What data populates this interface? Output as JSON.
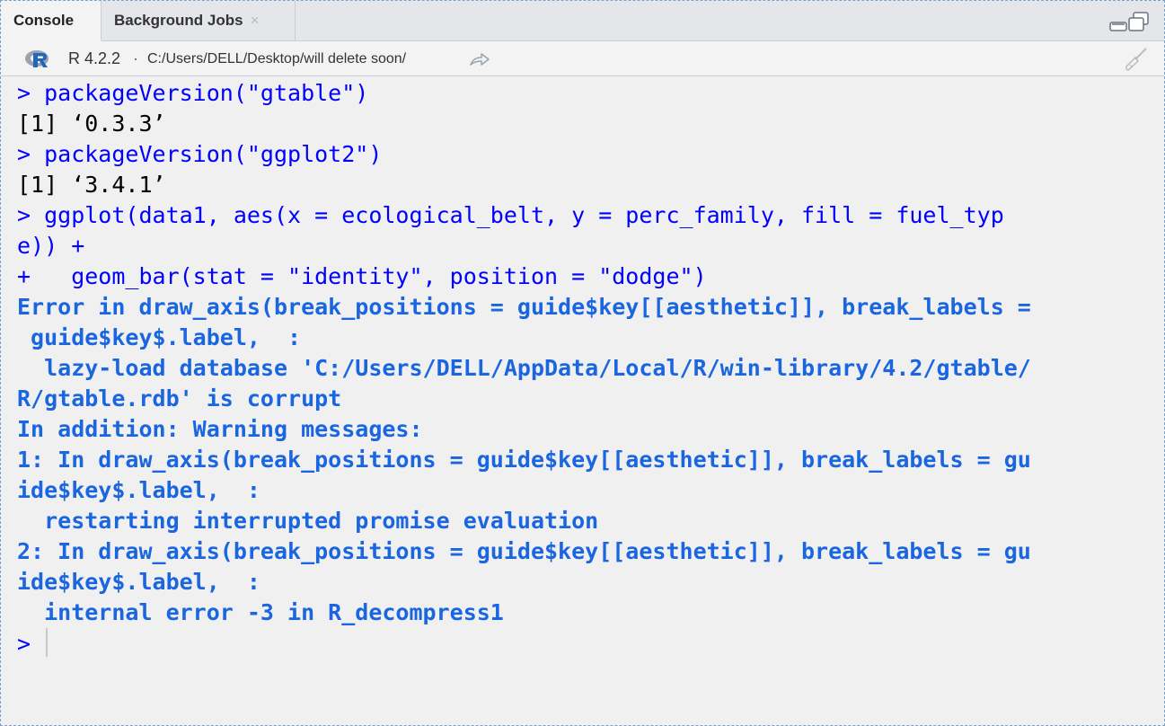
{
  "tabs": {
    "console": "Console",
    "background_jobs": "Background Jobs",
    "close_glyph": "×"
  },
  "infobar": {
    "r_version": "R 4.2.2",
    "separator": "·",
    "working_dir": "C:/Users/DELL/Desktop/will delete soon/"
  },
  "console_lines": [
    {
      "type": "cmd",
      "text": "> packageVersion(\"gtable\")"
    },
    {
      "type": "out",
      "text": "[1] ‘0.3.3’"
    },
    {
      "type": "cmd",
      "text": "> packageVersion(\"ggplot2\")"
    },
    {
      "type": "out",
      "text": "[1] ‘3.4.1’"
    },
    {
      "type": "cmd",
      "text": "> ggplot(data1, aes(x = ecological_belt, y = perc_family, fill = fuel_typ"
    },
    {
      "type": "cmd",
      "text": "e)) +"
    },
    {
      "type": "cmd",
      "text": "+   geom_bar(stat = \"identity\", position = \"dodge\")"
    },
    {
      "type": "err",
      "text": "Error in draw_axis(break_positions = guide$key[[aesthetic]], break_labels ="
    },
    {
      "type": "err",
      "text": " guide$key$.label,  :"
    },
    {
      "type": "err",
      "text": "  lazy-load database 'C:/Users/DELL/AppData/Local/R/win-library/4.2/gtable/"
    },
    {
      "type": "err",
      "text": "R/gtable.rdb' is corrupt"
    },
    {
      "type": "err",
      "text": "In addition: Warning messages:"
    },
    {
      "type": "err",
      "text": "1: In draw_axis(break_positions = guide$key[[aesthetic]], break_labels = gu"
    },
    {
      "type": "err",
      "text": "ide$key$.label,  :"
    },
    {
      "type": "err",
      "text": "  restarting interrupted promise evaluation"
    },
    {
      "type": "err",
      "text": "2: In draw_axis(break_positions = guide$key[[aesthetic]], break_labels = gu"
    },
    {
      "type": "err",
      "text": "ide$key$.label,  :"
    },
    {
      "type": "err",
      "text": "  internal error -3 in R_decompress1"
    }
  ],
  "prompt": ">",
  "colors": {
    "command": "#0000ff",
    "output": "#000000",
    "error": "#1a66e0"
  },
  "icons": {
    "r_logo": "r-logo-icon",
    "goto_dir": "goto-directory-icon",
    "minimize": "minimize-icon",
    "restore": "restore-icon",
    "clear_console": "broom-icon"
  }
}
